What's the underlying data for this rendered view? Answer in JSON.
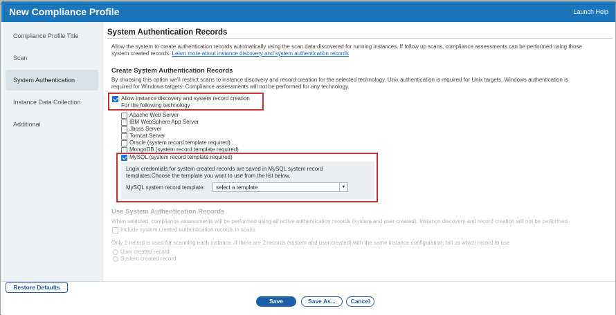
{
  "window": {
    "title": "New Compliance Profile",
    "help_link": "Launch Help"
  },
  "sidebar": {
    "items": [
      {
        "label": "Compliance Profile Title",
        "active": false
      },
      {
        "label": "Scan",
        "active": false
      },
      {
        "label": "System Authentication",
        "active": true
      },
      {
        "label": "Instance Data Collection",
        "active": false
      },
      {
        "label": "Additional",
        "active": false
      }
    ]
  },
  "main": {
    "heading": "System Authentication Records",
    "intro_line1": "Allow the system to create authentication records automatically using the scan data discovered for running instances. If follow up scans, compliance assessments can be performed using those",
    "intro_line2": "system created records.",
    "intro_link": "Learn more about instance discovery and system authentication records",
    "create_section": {
      "heading": "Create System Authentication Records",
      "desc_line1": "By choosing this option we'll restrict scans to instance discovery and record creation for the selected technology. Unix authentication is required for Unix targets. Windows authentication is",
      "desc_line2": "required for Windows targets. Compliance assessments will not be performed for any technology.",
      "allow_label": "Allow instance discovery and system record creation",
      "allow_checked": true,
      "tech_sublabel": "For the following technology",
      "technologies": [
        {
          "label": "Apache Web Server",
          "checked": false,
          "enabled": true
        },
        {
          "label": "IBM WebSphere App Server",
          "checked": false,
          "enabled": true
        },
        {
          "label": "Jboss Server",
          "checked": false,
          "enabled": true
        },
        {
          "label": "Tomcat Server",
          "checked": false,
          "enabled": true
        },
        {
          "label": "Oracle (system record template required)",
          "checked": false,
          "enabled": true
        },
        {
          "label": "MongoDB (system record template required)",
          "checked": false,
          "enabled": true
        },
        {
          "label": "MySQL (system record template required)",
          "checked": true,
          "enabled": true
        }
      ],
      "mysql_note_line1": "Login credentials for system created records are saved in MySQL system record",
      "mysql_note_line2": "templates.Choose the template you want to use from the list below.",
      "mysql_template_label": "MySQL system record template:",
      "mysql_template_value": "select a template"
    },
    "use_section": {
      "heading": "Use System Authentication Records",
      "desc": "When selected, compliance assessments will be performed using all active authentication records (system and user created). Instance discovery and record creation will not be performed.",
      "include_label": "Include system created authentication records in scans",
      "only_one_desc": "Only 1 record is used for scanning each instance. If there are 2 records (system and user created) with the same instance configuration, tell us which record to use",
      "radio_user": "User created record",
      "radio_system": "System created record"
    }
  },
  "footer": {
    "restore_label": "Restore Defaults",
    "save_label": "Save",
    "save_as_label": "Save As...",
    "cancel_label": "Cancel"
  },
  "colors": {
    "brand": "#1b75bb",
    "highlight": "#d32f2f",
    "button": "#1b5fa8"
  }
}
